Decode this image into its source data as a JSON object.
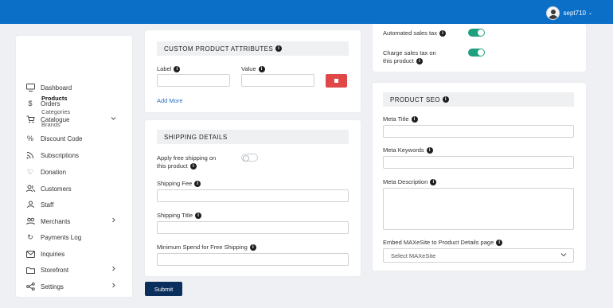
{
  "header": {
    "username": "sept710",
    "user_caret": "⌄"
  },
  "sidebar": {
    "items": [
      {
        "label": "Dashboard",
        "icon": "monitor-icon"
      },
      {
        "label": "Orders",
        "icon": "dollar-icon"
      },
      {
        "label": "Catalogue",
        "icon": "cart-icon"
      },
      {
        "label": "Discount Code",
        "icon": "percent-icon"
      },
      {
        "label": "Subscriptions",
        "icon": "rss-icon"
      },
      {
        "label": "Donation",
        "icon": "heart-icon"
      },
      {
        "label": "Customers",
        "icon": "users-icon"
      },
      {
        "label": "Staff",
        "icon": "staff-icon"
      },
      {
        "label": "Merchants",
        "icon": "merchants-icon"
      },
      {
        "label": "Payments Log",
        "icon": "refresh-icon"
      },
      {
        "label": "Inquiries",
        "icon": "mail-icon"
      },
      {
        "label": "Storefront",
        "icon": "folder-icon"
      },
      {
        "label": "Settings",
        "icon": "share-icon"
      }
    ],
    "catalogue_sub": [
      "Products",
      "Categories",
      "Brands"
    ]
  },
  "custom_attributes": {
    "title": "CUSTOM PRODUCT ATTRIBUTES",
    "label_label": "Label",
    "value_label": "Value",
    "label_value": "",
    "value_value": "",
    "add_more": "Add More"
  },
  "shipping": {
    "title": "SHIPPING DETAILS",
    "free_shipping_line1": "Apply free shipping on",
    "free_shipping_line2": "this product",
    "free_shipping_enabled": false,
    "fee_label": "Shipping Fee",
    "fee_value": "",
    "title_label": "Shipping Title",
    "title_value": "",
    "min_spend_label": "Minimum Spend for Free Shipping",
    "min_spend_value": ""
  },
  "tax": {
    "automated_label": "Automated sales tax",
    "automated_enabled": true,
    "charge_line1": "Charge sales tax on",
    "charge_line2": "this product",
    "charge_enabled": true
  },
  "seo": {
    "title": "PRODUCT SEO",
    "meta_title_label": "Meta Title",
    "meta_title_value": "",
    "meta_keywords_label": "Meta Keywords",
    "meta_keywords_value": "",
    "meta_description_label": "Meta Description",
    "meta_description_value": "",
    "embed_label": "Embed MAXeSite to Product Details page",
    "embed_selected": "Select MAXeSite"
  },
  "actions": {
    "submit": "Submit"
  },
  "colors": {
    "topbar": "#0b6ec7",
    "toggle_on": "#1e9f7d",
    "delete": "#e04848",
    "submit": "#0b2f5c",
    "link": "#2a6ec3"
  }
}
